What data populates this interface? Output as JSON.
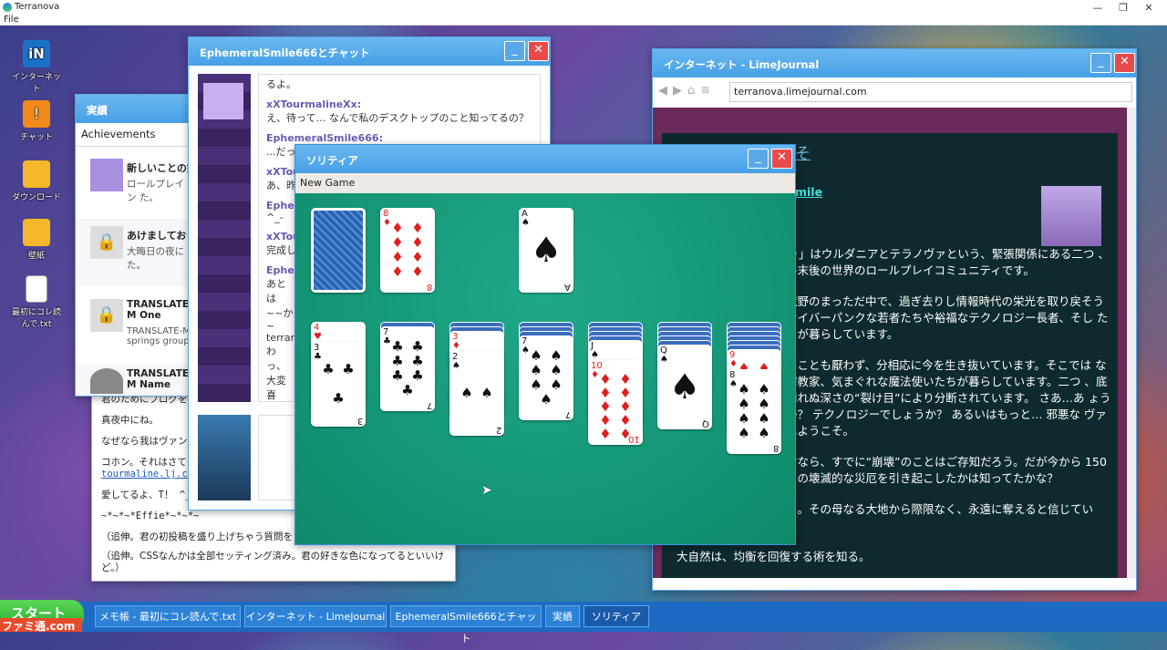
{
  "os": {
    "app_title": "Terranova",
    "menu_file": "File"
  },
  "desktop_icons": [
    {
      "label": "インターネット",
      "icon": "globe-icon"
    },
    {
      "label": "チャット",
      "icon": "chat-icon"
    },
    {
      "label": "ダウンロード",
      "icon": "folder-icon"
    },
    {
      "label": "壁紙",
      "icon": "folder-icon"
    },
    {
      "label": "最初にコレ読んで.txt",
      "icon": "text-file-icon"
    }
  ],
  "achievements": {
    "title": "実績",
    "header": "Achievements",
    "items": [
      {
        "title": "新しいことの始",
        "desc": "ロールプレイン た。"
      },
      {
        "title": "あけましてお",
        "desc": "大晦日の夜に た。"
      },
      {
        "title": "TRANSLATE-M One",
        "desc": "TRANSLATE-M springs group"
      },
      {
        "title": "TRANSLATE-M Name",
        "desc": ""
      }
    ]
  },
  "notepad": {
    "lines": [
      "君のためにブログを",
      "真夜中にね。",
      "なぜなら我はヴァン",
      "コホン。それはさて",
      "tourmaline.lj.com",
      "愛してるよ、T！ ^_",
      "~*~*~*Effie*~*~*~",
      "（追伸。君の初投稿を盛り上げちゃう質問を ら使ってみて！",
      "（追伸。CSSなんかは全部セッティング済み。君の好きな色になってるといいけど。）"
    ]
  },
  "chat": {
    "title": "EphemeralSmile666とチャット",
    "messages": [
      {
        "name": "",
        "text": "るよ。"
      },
      {
        "name": "xXTourmalineXx:",
        "text": "え、待って… なんで私のデスクトップのこと知ってるの？"
      },
      {
        "name": "EphemeralSmile666:",
        "text": "...だっ"
      },
      {
        "name": "xXTou",
        "text": "あ、昨"
      },
      {
        "name": "Ephe",
        "text": "^_-"
      },
      {
        "name": "xXTou",
        "text": "完成し"
      },
      {
        "name": "Ephem",
        "text": "あとは ~~か~ terranc わっ、 大変喜 私、そ 君より 投稿し"
      }
    ]
  },
  "browser": {
    "title": "インターネット - LimeJournal",
    "url": "terranova.limejournal.com",
    "heading": "そ",
    "author_link": "mile",
    "paragraphs": [
      "a）」はウルダニアとテラノヴァという、緊張関係にある二つ 、終末後の世界のロールプレイコミュニティです。",
      "荒野のまっただ中で、過ぎ去りし情報時代の栄光を取り戻そう サイバーパンクな若者たちや裕福なテクノロジー長者、そし たちが暮らしています。",
      "ることも厭わず、分相応に今を生き抜いています。そこでは な宗教家、気まぐれな魔法使いたちが暮らしています。二つ 、底知れぬ深さの“裂け目”により分断されています。 さあ…あ ょうか？ テクノロジーでしょうか？ あるいはもっと… 邪悪な ヴァへようこそ。",
      "君なら、すでに“崩壊”のことはご存知だろう。だが今から 150 この壊滅的な災厄を引き起こしたかは知ってたかな？",
      "よ。その母なる大地から際限なく、永遠に奪えると信じてい",
      "大自然は、均衡を回復する術を知る。"
    ]
  },
  "solitaire": {
    "title": "ソリティア",
    "new_game": "New Game",
    "stock": "back",
    "waste": {
      "rank": "8",
      "suit": "♦",
      "color": "red"
    },
    "foundation": [
      {
        "rank": "A",
        "suit": "♠",
        "color": "blk"
      }
    ],
    "tableau": [
      {
        "hidden": 0,
        "cards": [
          {
            "rank": "4",
            "suit": "♥",
            "color": "red"
          },
          {
            "rank": "3",
            "suit": "♣",
            "color": "blk"
          }
        ]
      },
      {
        "hidden": 1,
        "cards": [
          {
            "rank": "7",
            "suit": "♣",
            "color": "blk"
          }
        ]
      },
      {
        "hidden": 2,
        "cards": [
          {
            "rank": "3",
            "suit": "♦",
            "color": "red"
          },
          {
            "rank": "2",
            "suit": "♠",
            "color": "blk"
          }
        ]
      },
      {
        "hidden": 3,
        "cards": [
          {
            "rank": "7",
            "suit": "♠",
            "color": "blk"
          }
        ]
      },
      {
        "hidden": 4,
        "cards": [
          {
            "rank": "J",
            "suit": "♠",
            "color": "blk"
          },
          {
            "rank": "10",
            "suit": "♦",
            "color": "red"
          }
        ]
      },
      {
        "hidden": 5,
        "cards": [
          {
            "rank": "Q",
            "suit": "♠",
            "color": "blk"
          }
        ]
      },
      {
        "hidden": 6,
        "cards": [
          {
            "rank": "9",
            "suit": "♦",
            "color": "red"
          },
          {
            "rank": "8",
            "suit": "♠",
            "color": "blk"
          }
        ]
      }
    ]
  },
  "taskbar": {
    "start": "スタート",
    "items": [
      "メモ帳 - 最初にコレ読んで.txt",
      "インターネット - LimeJournal",
      "EphemeralSmile666とチャット",
      "実績",
      "ソリティア"
    ],
    "watermark": "ファミ通.com"
  }
}
